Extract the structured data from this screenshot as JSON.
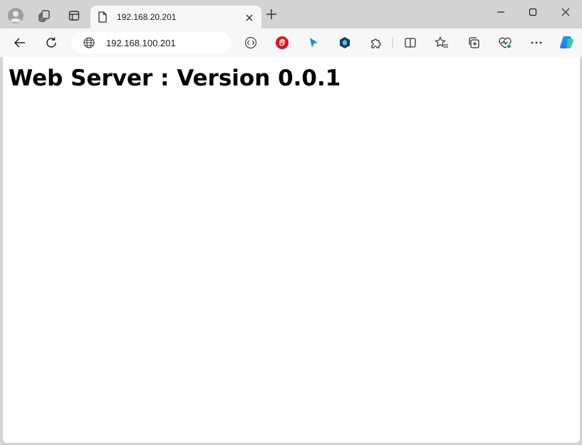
{
  "tab": {
    "title": "192.168.20.201",
    "close_label": "×"
  },
  "new_tab_label": "+",
  "address_bar": {
    "url": "192.168.100.201"
  },
  "page": {
    "heading": "Web Server : Version 0.0.1"
  },
  "icons": {
    "profile": "profile-avatar-icon",
    "workspaces": "workspaces-icon",
    "tab_actions": "tab-actions-icon",
    "back": "back-arrow-icon",
    "refresh": "refresh-icon",
    "site_info": "globe-icon",
    "immersive_reader": "immersive-reader-icon",
    "extension_1": "opera-red-shield-icon",
    "extension_2": "blue-cursor-icon",
    "extension_3": "dark-hex-icon",
    "extensions": "puzzle-icon",
    "split_screen": "split-screen-icon",
    "favorites": "favorites-star-icon",
    "collections": "collections-icon",
    "browser_essentials": "browser-essentials-icon",
    "more": "more-dots-icon",
    "copilot": "copilot-icon"
  },
  "colors": {
    "frame": "#d3d3d3",
    "toolbar": "#f7f7f7",
    "content": "#ffffff",
    "extension_red": "#e0121b",
    "extension_blue": "#1e88e5",
    "extension_navy": "#1f3a5a"
  }
}
